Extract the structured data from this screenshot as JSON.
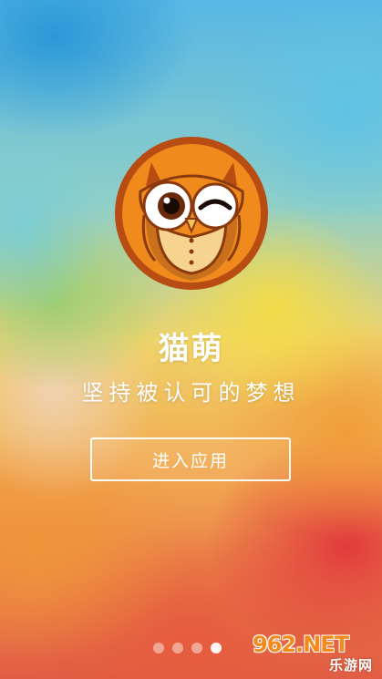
{
  "app": {
    "name": "猫萌",
    "slogan": "坚持被认可的梦想"
  },
  "enter_button": {
    "label": "进入应用"
  },
  "pager": {
    "total": 4,
    "current": 4
  },
  "watermark": {
    "logo": "962.NET",
    "text": "乐游网"
  },
  "icons": {
    "logo": "owl-logo-icon"
  },
  "colors": {
    "owl_ring": "#b84d13",
    "owl_face": "#f08a1d",
    "text": "#ffffff"
  }
}
